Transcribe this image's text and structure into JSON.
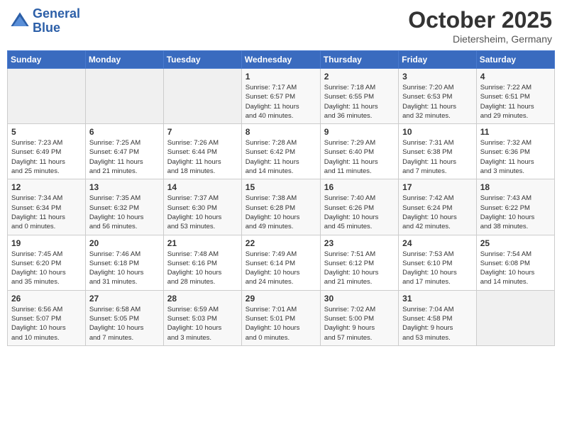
{
  "header": {
    "logo_line1": "General",
    "logo_line2": "Blue",
    "month": "October 2025",
    "location": "Dietersheim, Germany"
  },
  "weekdays": [
    "Sunday",
    "Monday",
    "Tuesday",
    "Wednesday",
    "Thursday",
    "Friday",
    "Saturday"
  ],
  "weeks": [
    [
      {
        "day": "",
        "info": ""
      },
      {
        "day": "",
        "info": ""
      },
      {
        "day": "",
        "info": ""
      },
      {
        "day": "1",
        "info": "Sunrise: 7:17 AM\nSunset: 6:57 PM\nDaylight: 11 hours\nand 40 minutes."
      },
      {
        "day": "2",
        "info": "Sunrise: 7:18 AM\nSunset: 6:55 PM\nDaylight: 11 hours\nand 36 minutes."
      },
      {
        "day": "3",
        "info": "Sunrise: 7:20 AM\nSunset: 6:53 PM\nDaylight: 11 hours\nand 32 minutes."
      },
      {
        "day": "4",
        "info": "Sunrise: 7:22 AM\nSunset: 6:51 PM\nDaylight: 11 hours\nand 29 minutes."
      }
    ],
    [
      {
        "day": "5",
        "info": "Sunrise: 7:23 AM\nSunset: 6:49 PM\nDaylight: 11 hours\nand 25 minutes."
      },
      {
        "day": "6",
        "info": "Sunrise: 7:25 AM\nSunset: 6:47 PM\nDaylight: 11 hours\nand 21 minutes."
      },
      {
        "day": "7",
        "info": "Sunrise: 7:26 AM\nSunset: 6:44 PM\nDaylight: 11 hours\nand 18 minutes."
      },
      {
        "day": "8",
        "info": "Sunrise: 7:28 AM\nSunset: 6:42 PM\nDaylight: 11 hours\nand 14 minutes."
      },
      {
        "day": "9",
        "info": "Sunrise: 7:29 AM\nSunset: 6:40 PM\nDaylight: 11 hours\nand 11 minutes."
      },
      {
        "day": "10",
        "info": "Sunrise: 7:31 AM\nSunset: 6:38 PM\nDaylight: 11 hours\nand 7 minutes."
      },
      {
        "day": "11",
        "info": "Sunrise: 7:32 AM\nSunset: 6:36 PM\nDaylight: 11 hours\nand 3 minutes."
      }
    ],
    [
      {
        "day": "12",
        "info": "Sunrise: 7:34 AM\nSunset: 6:34 PM\nDaylight: 11 hours\nand 0 minutes."
      },
      {
        "day": "13",
        "info": "Sunrise: 7:35 AM\nSunset: 6:32 PM\nDaylight: 10 hours\nand 56 minutes."
      },
      {
        "day": "14",
        "info": "Sunrise: 7:37 AM\nSunset: 6:30 PM\nDaylight: 10 hours\nand 53 minutes."
      },
      {
        "day": "15",
        "info": "Sunrise: 7:38 AM\nSunset: 6:28 PM\nDaylight: 10 hours\nand 49 minutes."
      },
      {
        "day": "16",
        "info": "Sunrise: 7:40 AM\nSunset: 6:26 PM\nDaylight: 10 hours\nand 45 minutes."
      },
      {
        "day": "17",
        "info": "Sunrise: 7:42 AM\nSunset: 6:24 PM\nDaylight: 10 hours\nand 42 minutes."
      },
      {
        "day": "18",
        "info": "Sunrise: 7:43 AM\nSunset: 6:22 PM\nDaylight: 10 hours\nand 38 minutes."
      }
    ],
    [
      {
        "day": "19",
        "info": "Sunrise: 7:45 AM\nSunset: 6:20 PM\nDaylight: 10 hours\nand 35 minutes."
      },
      {
        "day": "20",
        "info": "Sunrise: 7:46 AM\nSunset: 6:18 PM\nDaylight: 10 hours\nand 31 minutes."
      },
      {
        "day": "21",
        "info": "Sunrise: 7:48 AM\nSunset: 6:16 PM\nDaylight: 10 hours\nand 28 minutes."
      },
      {
        "day": "22",
        "info": "Sunrise: 7:49 AM\nSunset: 6:14 PM\nDaylight: 10 hours\nand 24 minutes."
      },
      {
        "day": "23",
        "info": "Sunrise: 7:51 AM\nSunset: 6:12 PM\nDaylight: 10 hours\nand 21 minutes."
      },
      {
        "day": "24",
        "info": "Sunrise: 7:53 AM\nSunset: 6:10 PM\nDaylight: 10 hours\nand 17 minutes."
      },
      {
        "day": "25",
        "info": "Sunrise: 7:54 AM\nSunset: 6:08 PM\nDaylight: 10 hours\nand 14 minutes."
      }
    ],
    [
      {
        "day": "26",
        "info": "Sunrise: 6:56 AM\nSunset: 5:07 PM\nDaylight: 10 hours\nand 10 minutes."
      },
      {
        "day": "27",
        "info": "Sunrise: 6:58 AM\nSunset: 5:05 PM\nDaylight: 10 hours\nand 7 minutes."
      },
      {
        "day": "28",
        "info": "Sunrise: 6:59 AM\nSunset: 5:03 PM\nDaylight: 10 hours\nand 3 minutes."
      },
      {
        "day": "29",
        "info": "Sunrise: 7:01 AM\nSunset: 5:01 PM\nDaylight: 10 hours\nand 0 minutes."
      },
      {
        "day": "30",
        "info": "Sunrise: 7:02 AM\nSunset: 5:00 PM\nDaylight: 9 hours\nand 57 minutes."
      },
      {
        "day": "31",
        "info": "Sunrise: 7:04 AM\nSunset: 4:58 PM\nDaylight: 9 hours\nand 53 minutes."
      },
      {
        "day": "",
        "info": ""
      }
    ]
  ]
}
